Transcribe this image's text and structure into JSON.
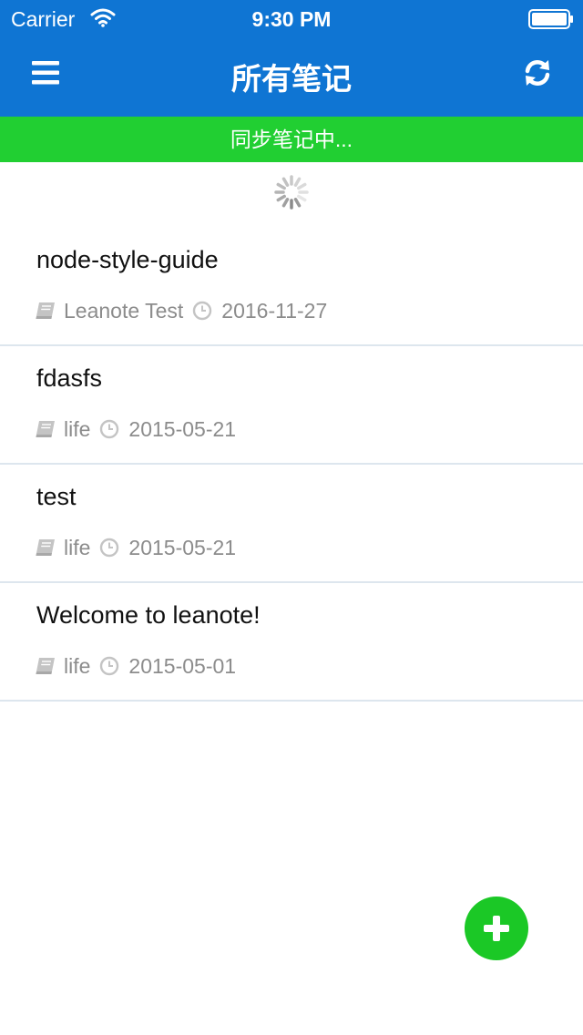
{
  "status_bar": {
    "carrier": "Carrier",
    "time": "9:30 PM"
  },
  "header": {
    "title": "所有笔记",
    "background_color": "#0f75d3",
    "menu_icon": "hamburger-menu-icon",
    "refresh_icon": "refresh-icon"
  },
  "sync_banner": {
    "text": "同步笔记中...",
    "background_color": "#21cf32"
  },
  "notes": [
    {
      "title": "node-style-guide",
      "notebook": "Leanote Test",
      "date": "2016-11-27"
    },
    {
      "title": "fdasfs",
      "notebook": "life",
      "date": "2015-05-21"
    },
    {
      "title": "test",
      "notebook": "life",
      "date": "2015-05-21"
    },
    {
      "title": "Welcome to leanote!",
      "notebook": "life",
      "date": "2015-05-01"
    }
  ],
  "fab": {
    "icon": "plus-icon",
    "color": "#1bc826"
  }
}
